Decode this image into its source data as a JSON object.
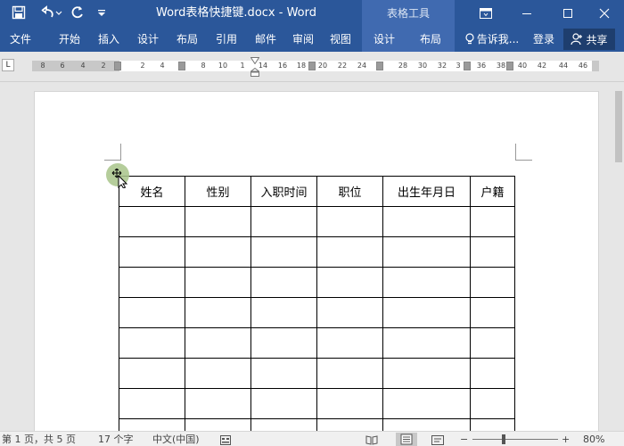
{
  "app": {
    "title": "Word表格快捷键.docx  -  Word",
    "context_group": "表格工具"
  },
  "quick_access": {
    "icons": [
      "save-icon",
      "undo-icon",
      "redo-icon",
      "customize-icon"
    ]
  },
  "window_controls": {
    "icons": [
      "ribbon-display-icon",
      "minimize-icon",
      "maximize-icon",
      "close-icon"
    ]
  },
  "ribbon": {
    "tabs": [
      "文件",
      "开始",
      "插入",
      "设计",
      "布局",
      "引用",
      "邮件",
      "审阅",
      "视图"
    ],
    "context_tabs": [
      "设计",
      "布局"
    ],
    "tell_me": "告诉我...",
    "login": "登录",
    "share": "共享"
  },
  "ruler": {
    "tab_selector": "L",
    "left_labels": [
      "8",
      "6",
      "4",
      "2"
    ],
    "mid_labels": [
      "2",
      "4",
      "8",
      "10",
      "1",
      "14",
      "16",
      "18",
      "20",
      "22",
      "24",
      "28",
      "30",
      "32",
      "3",
      "36",
      "38",
      "40",
      "42",
      "44",
      "46"
    ]
  },
  "table": {
    "headers": [
      "姓名",
      "性别",
      "入职时间",
      "职位",
      "出生年月日",
      "户籍"
    ],
    "empty_rows": 8
  },
  "status": {
    "page": "第 1 页，共 5 页",
    "words": "17 个字",
    "language": "中文(中国)",
    "zoom": "80%",
    "zoom_value": 80
  },
  "colors": {
    "accent": "#2b579a",
    "context": "#406ab0",
    "page": "#ffffff",
    "background": "#e6e6e6"
  }
}
